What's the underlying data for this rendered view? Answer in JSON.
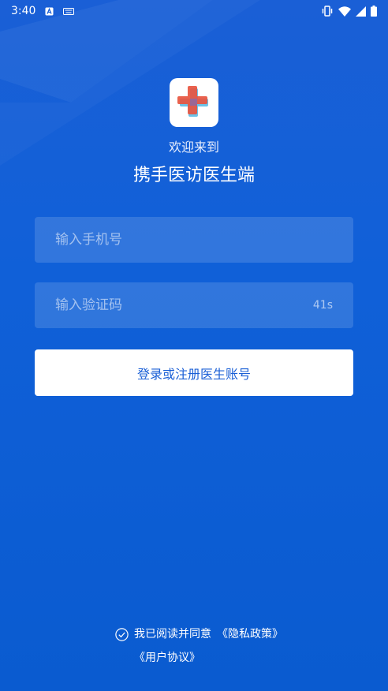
{
  "status_bar": {
    "time": "3:40",
    "icons": [
      "notification-a-icon",
      "keyboard-icon",
      "vibrate-icon",
      "wifi-icon",
      "signal-icon",
      "battery-icon"
    ]
  },
  "welcome": "欢迎来到",
  "app_title": "携手医访医生端",
  "phone_input": {
    "placeholder": "输入手机号",
    "value": ""
  },
  "code_input": {
    "placeholder": "输入验证码",
    "value": "",
    "countdown": "41s"
  },
  "login_button": "登录或注册医生账号",
  "agreement": {
    "prefix": "我已阅读并同意",
    "privacy_link": "《隐私政策》",
    "user_link": "《用户协议》"
  },
  "colors": {
    "background": "#1a5fd6",
    "button_text": "#1a5fd6",
    "logo_red": "#e8553f",
    "logo_blue": "#6cc3e8"
  }
}
